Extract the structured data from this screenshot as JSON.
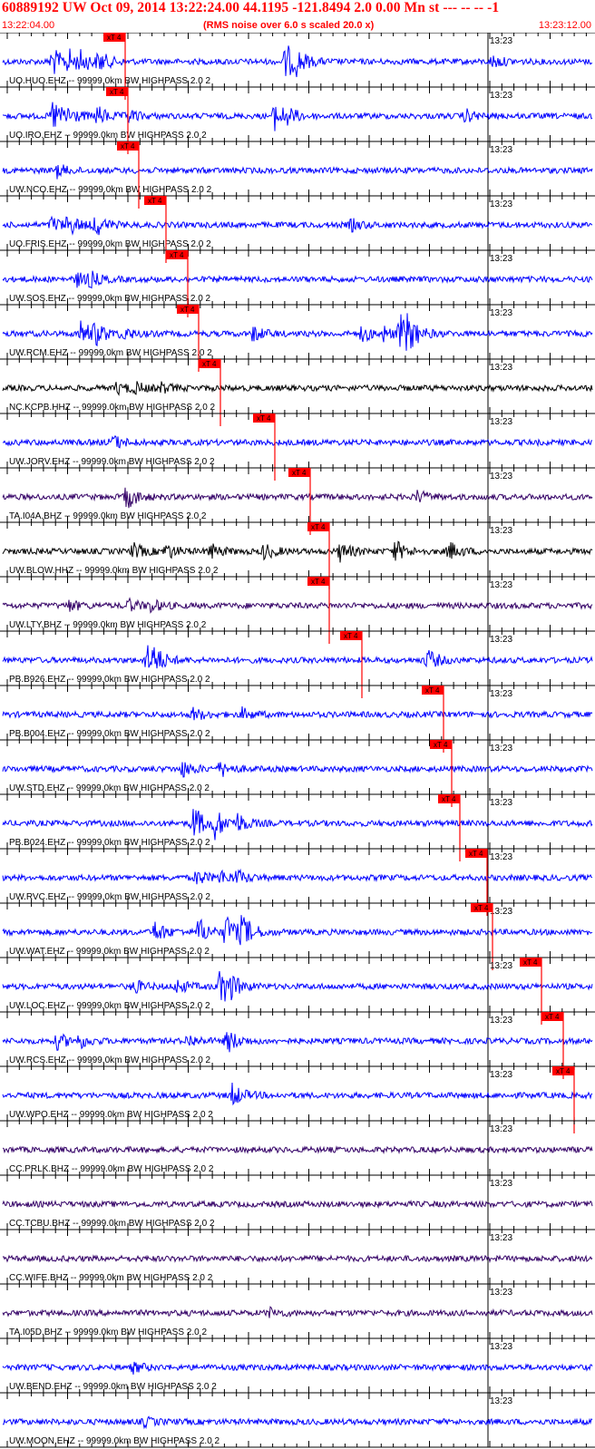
{
  "header": {
    "title": "60889192 UW Oct 09, 2014 13:22:24.00   44.1195 -121.8494  2.0 0.00 Mn st --- -- --  -1",
    "start_time": "13:22:04.00",
    "scale_note": "(RMS noise over 6.0 s scaled 20.0 x)",
    "end_time": "13:23:12.00"
  },
  "colors": {
    "header_text": "#ff0000",
    "pick_box": "#ff0000",
    "grid": "#000000",
    "trace_blue": "#0000ff",
    "trace_black": "#000000",
    "trace_purple": "#330066"
  },
  "chart_data": {
    "type": "line",
    "x_start": "13:22:04.00",
    "x_end": "13:23:12.00",
    "minute_mark_label": "13:23",
    "pick_label": "xT 4",
    "traces": [
      {
        "label": "UO.HUO.EHZ -- 99999.0km BW  HIGHPASS  2.0  2",
        "color": "blue",
        "pick": 4.5,
        "events": [
          [
            4.5,
            5.0
          ],
          [
            6.0,
            3.5
          ],
          [
            7.2,
            2.5
          ],
          [
            8.8,
            3.0
          ],
          [
            26.0,
            6.0
          ],
          [
            27.0,
            2.5
          ],
          [
            45.0,
            2.0
          ]
        ]
      },
      {
        "label": "UO.IRO.EHZ -- 99999.0km BW  HIGHPASS  2.0  2",
        "color": "blue",
        "pick": 4.6,
        "events": [
          [
            4.6,
            5.5
          ],
          [
            5.8,
            2.5
          ],
          [
            8.7,
            3.0
          ],
          [
            11.5,
            2.0
          ],
          [
            25.0,
            4.5
          ],
          [
            26.0,
            2.0
          ],
          [
            42.5,
            2.0
          ]
        ]
      },
      {
        "label": "UW.NCO.EHZ -- 99999.0km BW  HIGHPASS  2.0  2",
        "color": "blue",
        "pick": 5.0,
        "events": [
          [
            5.0,
            2.0
          ]
        ]
      },
      {
        "label": "UO.FRIS.EHZ -- 99999.0km BW  HIGHPASS  2.0  2",
        "color": "blue",
        "pick": 6.0,
        "events": [
          [
            4.5,
            2.5
          ],
          [
            6.0,
            3.0
          ],
          [
            8.5,
            3.5
          ],
          [
            32.0,
            1.8
          ]
        ]
      },
      {
        "label": "UW.SOS.EHZ -- 99999.0km BW  HIGHPASS  2.0  2",
        "color": "blue",
        "pick": 6.8,
        "events": [
          [
            6.8,
            2.2
          ],
          [
            8.0,
            2.0
          ]
        ]
      },
      {
        "label": "UW.RCM.EHZ -- 99999.0km BW  HIGHPASS  2.0  2",
        "color": "blue",
        "pick": 7.2,
        "events": [
          [
            7.2,
            4.5
          ],
          [
            8.5,
            3.0
          ],
          [
            11.0,
            2.0
          ],
          [
            23.0,
            2.5
          ],
          [
            33.0,
            2.5
          ],
          [
            35.0,
            2.0
          ],
          [
            36.5,
            6.0
          ],
          [
            37.2,
            4.0
          ]
        ]
      },
      {
        "label": "NC.KCPB.HHZ -- 99999.0km BW  HIGHPASS  2.0  2",
        "color": "black",
        "pick": 8.0,
        "events": [
          [
            10.5,
            1.8
          ],
          [
            12.0,
            1.8
          ],
          [
            14.5,
            1.5
          ]
        ]
      },
      {
        "label": "UW.JORV.EHZ -- 99999.0km BW  HIGHPASS  2.0  2",
        "color": "blue",
        "pick": 10.0,
        "events": [
          [
            10.0,
            2.5
          ]
        ]
      },
      {
        "label": "TA.I04A.BHZ -- 99999.0km BW  HIGHPASS  2.0  2",
        "color": "purple",
        "pick": 11.3,
        "events": [
          [
            11.3,
            4.0
          ],
          [
            38.0,
            2.0
          ]
        ]
      },
      {
        "label": "UW.BLOW.HHZ -- 99999.0km BW  HIGHPASS  2.0  2",
        "color": "black",
        "pick": 12.0,
        "events": [
          [
            12.0,
            2.5
          ],
          [
            15.0,
            2.5
          ],
          [
            19.0,
            2.5
          ],
          [
            24.0,
            2.5
          ],
          [
            31.0,
            3.0
          ],
          [
            36.0,
            3.5
          ],
          [
            41.0,
            3.0
          ]
        ]
      },
      {
        "label": "UW.LTY.BHZ -- 99999.0km BW  HIGHPASS  2.0  2",
        "color": "purple",
        "pick": 12.0,
        "events": [
          [
            6.0,
            1.8
          ],
          [
            11.5,
            2.0
          ],
          [
            13.5,
            2.0
          ]
        ]
      },
      {
        "label": "PB.B926.EHZ -- 99999.0km BW  HIGHPASS  2.0  2",
        "color": "blue",
        "pick": 13.2,
        "events": [
          [
            13.2,
            5.0
          ],
          [
            13.8,
            3.0
          ],
          [
            39.0,
            3.5
          ]
        ]
      },
      {
        "label": "PB.B004.EHZ -- 99999.0km BW  HIGHPASS  2.0  2",
        "color": "blue",
        "pick": 16.2,
        "events": [
          [
            17.5,
            2.0
          ],
          [
            22.0,
            1.8
          ]
        ]
      },
      {
        "label": "UW.STD.EHZ -- 99999.0km BW  HIGHPASS  2.0  2",
        "color": "blue",
        "pick": 16.5,
        "events": [
          [
            16.5,
            2.5
          ],
          [
            20.0,
            2.5
          ]
        ]
      },
      {
        "label": "PB.B024.EHZ -- 99999.0km BW  HIGHPASS  2.0  2",
        "color": "blue",
        "pick": 16.8,
        "events": [
          [
            17.5,
            6.0
          ],
          [
            19.5,
            4.5
          ],
          [
            21.5,
            3.0
          ]
        ]
      },
      {
        "label": "UW.RVC.EHZ -- 99999.0km BW  HIGHPASS  2.0  2",
        "color": "blue",
        "pick": 17.8,
        "events": [
          [
            17.8,
            2.5
          ],
          [
            20.0,
            2.0
          ],
          [
            21.5,
            2.0
          ]
        ]
      },
      {
        "label": "UW.WAT.EHZ -- 99999.0km BW  HIGHPASS  2.0  2",
        "color": "blue",
        "pick": 18.0,
        "events": [
          [
            14.0,
            3.5
          ],
          [
            18.0,
            4.5
          ],
          [
            20.5,
            6.0
          ],
          [
            22.0,
            5.0
          ]
        ]
      },
      {
        "label": "UW.LOC.EHZ -- 99999.0km BW  HIGHPASS  2.0  2",
        "color": "blue",
        "pick": 19.8,
        "events": [
          [
            12.0,
            2.2
          ],
          [
            16.0,
            2.2
          ],
          [
            19.8,
            5.0
          ],
          [
            20.5,
            4.5
          ]
        ]
      },
      {
        "label": "UW.RCS.EHZ -- 99999.0km BW  HIGHPASS  2.0  2",
        "color": "blue",
        "pick": 20.6,
        "events": [
          [
            5.0,
            2.5
          ],
          [
            7.0,
            2.0
          ],
          [
            17.0,
            2.0
          ],
          [
            20.6,
            4.0
          ]
        ]
      },
      {
        "label": "UW.WPO.EHZ -- 99999.0km BW  HIGHPASS  2.0  2",
        "color": "blue",
        "pick": 21.0,
        "events": [
          [
            21.0,
            4.0
          ]
        ]
      },
      {
        "label": "CC.PRLK.BHZ -- 99999.0km BW  HIGHPASS  2.0  2",
        "color": "purple",
        "pick": null,
        "events": []
      },
      {
        "label": "CC.TCBU.BHZ -- 99999.0km BW  HIGHPASS  2.0  2",
        "color": "purple",
        "pick": null,
        "events": []
      },
      {
        "label": "CC.WIFE.BHZ -- 99999.0km BW  HIGHPASS  2.0  2",
        "color": "purple",
        "pick": null,
        "events": []
      },
      {
        "label": "TA.I05D.BHZ -- 99999.0km BW  HIGHPASS  2.0  2",
        "color": "purple",
        "pick": null,
        "events": [
          [
            24.5,
            1.5
          ]
        ]
      },
      {
        "label": "UW.BEND.EHZ -- 99999.0km BW  HIGHPASS  2.0  2",
        "color": "blue",
        "pick": null,
        "events": [
          [
            12.0,
            1.5
          ]
        ]
      },
      {
        "label": "UW.MOON.EHZ -- 99999.0km BW  HIGHPASS  2.0  2",
        "color": "blue",
        "pick": null,
        "events": [
          [
            13.0,
            1.3
          ]
        ]
      }
    ]
  }
}
